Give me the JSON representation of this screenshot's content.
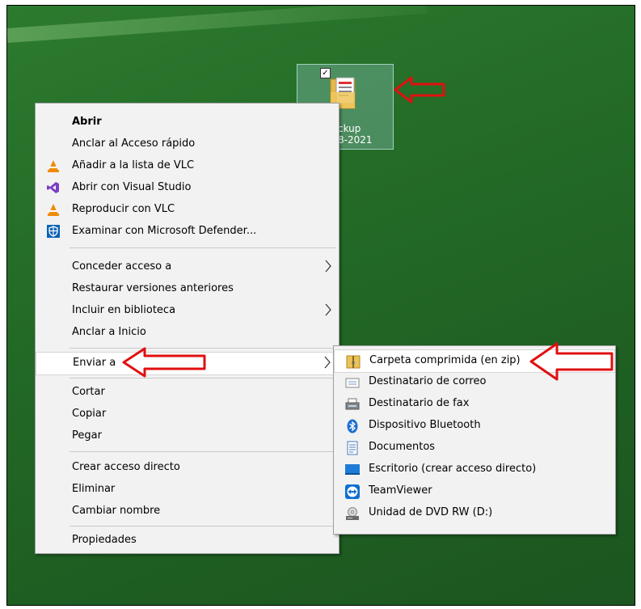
{
  "desktop_icon": {
    "label_line1": "ckup",
    "label_line2": "8-2021",
    "checkbox": "✓"
  },
  "context_menu": {
    "items": [
      {
        "label": "Abrir",
        "bold": true
      },
      {
        "label": "Anclar al Acceso rápido"
      },
      {
        "label": "Añadir a la lista de VLC",
        "icon": "vlc-icon"
      },
      {
        "label": "Abrir con Visual Studio",
        "icon": "visual-studio-icon"
      },
      {
        "label": "Reproducir con VLC",
        "icon": "vlc-icon"
      },
      {
        "label": "Examinar con Microsoft Defender...",
        "icon": "defender-shield-icon"
      },
      {
        "label": "Conceder acceso a",
        "submenu": true
      },
      {
        "label": "Restaurar versiones anteriores"
      },
      {
        "label": "Incluir en biblioteca",
        "submenu": true
      },
      {
        "label": "Anclar a Inicio"
      },
      {
        "label": "Enviar a",
        "submenu": true,
        "highlighted": true
      },
      {
        "label": "Cortar"
      },
      {
        "label": "Copiar"
      },
      {
        "label": "Pegar"
      },
      {
        "label": "Crear acceso directo"
      },
      {
        "label": "Eliminar"
      },
      {
        "label": "Cambiar nombre"
      },
      {
        "label": "Propiedades"
      }
    ]
  },
  "send_to_menu": {
    "items": [
      {
        "label": "Carpeta comprimida (en zip)",
        "icon": "zip-folder-icon",
        "highlighted": true
      },
      {
        "label": "Destinatario de correo",
        "icon": "mail-icon"
      },
      {
        "label": "Destinatario de fax",
        "icon": "fax-icon"
      },
      {
        "label": "Dispositivo Bluetooth",
        "icon": "bluetooth-icon"
      },
      {
        "label": "Documentos",
        "icon": "documents-icon"
      },
      {
        "label": "Escritorio (crear acceso directo)",
        "icon": "desktop-icon"
      },
      {
        "label": "TeamViewer",
        "icon": "teamviewer-icon"
      },
      {
        "label": "Unidad de DVD RW (D:)",
        "icon": "dvd-drive-icon"
      }
    ]
  },
  "colors": {
    "accent_arrow": "#e01010",
    "menu_bg": "#f2f2f2",
    "desktop_green": "#246c27"
  }
}
